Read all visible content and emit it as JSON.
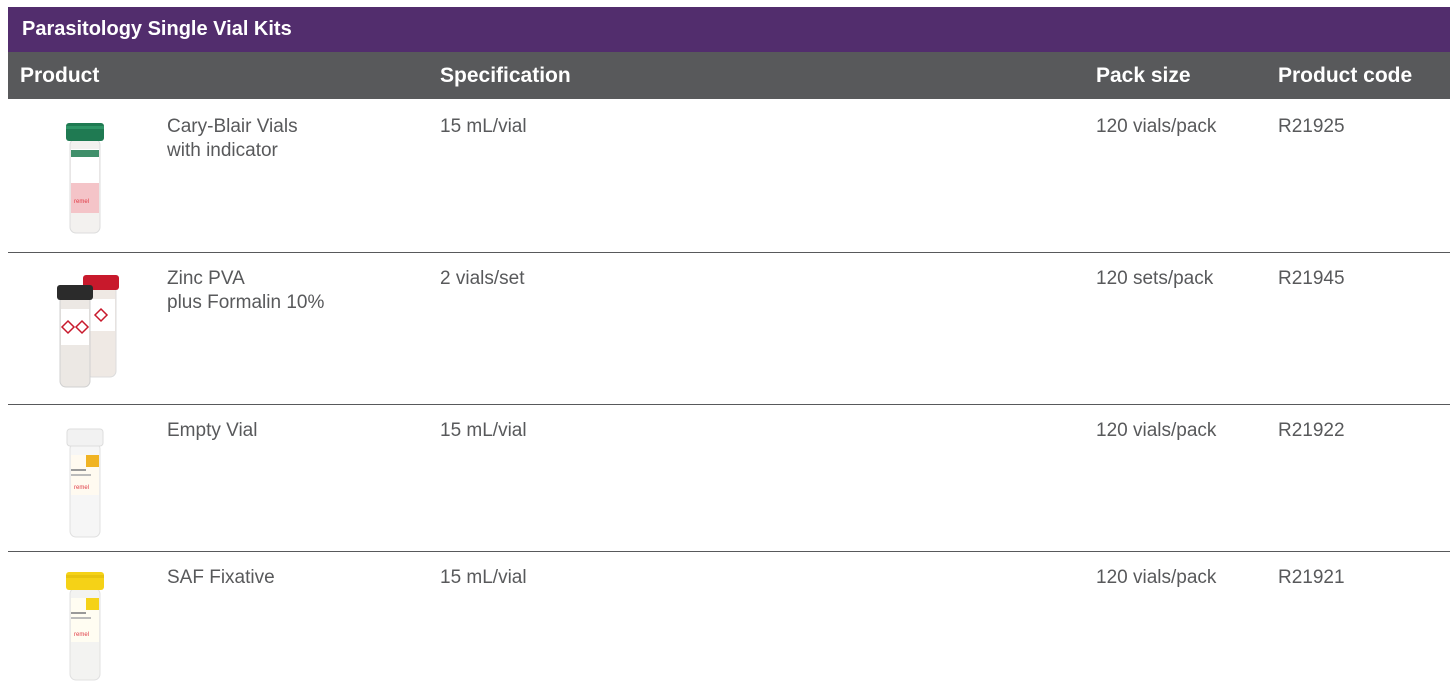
{
  "table": {
    "title": "Parasitology Single Vial Kits",
    "headers": {
      "product": "Product",
      "specification": "Specification",
      "pack_size": "Pack size",
      "product_code": "Product code"
    },
    "rows": [
      {
        "name_line1": "Cary-Blair Vials",
        "name_line2": "with indicator",
        "specification": "15 mL/vial",
        "pack_size": "120 vials/pack",
        "product_code": "R21925",
        "image": "cary-blair-vial-green-cap-icon",
        "cap_color": "#1f7a52",
        "label_color": "#e03a45"
      },
      {
        "name_line1": "Zinc PVA",
        "name_line2": "plus Formalin 10%",
        "specification": "2 vials/set",
        "pack_size": "120 sets/pack",
        "product_code": "R21945",
        "image": "zinc-pva-formalin-vial-pair-icon",
        "cap_colors": [
          "#2b2b2b",
          "#c8192c"
        ]
      },
      {
        "name_line1": "Empty Vial",
        "name_line2": "",
        "specification": "15 mL/vial",
        "pack_size": "120 vials/pack",
        "product_code": "R21922",
        "image": "empty-vial-white-cap-icon",
        "cap_color": "#f2f2f2",
        "label_color": "#f0b323"
      },
      {
        "name_line1": "SAF Fixative",
        "name_line2": "",
        "specification": "15 mL/vial",
        "pack_size": "120 vials/pack",
        "product_code": "R21921",
        "image": "saf-fixative-vial-yellow-cap-icon",
        "cap_color": "#f5d217",
        "label_color": "#f5d217"
      }
    ]
  },
  "colors": {
    "title_bg": "#522d6d",
    "header_bg": "#58595b",
    "body_text": "#58595b",
    "divider": "#58595b"
  }
}
